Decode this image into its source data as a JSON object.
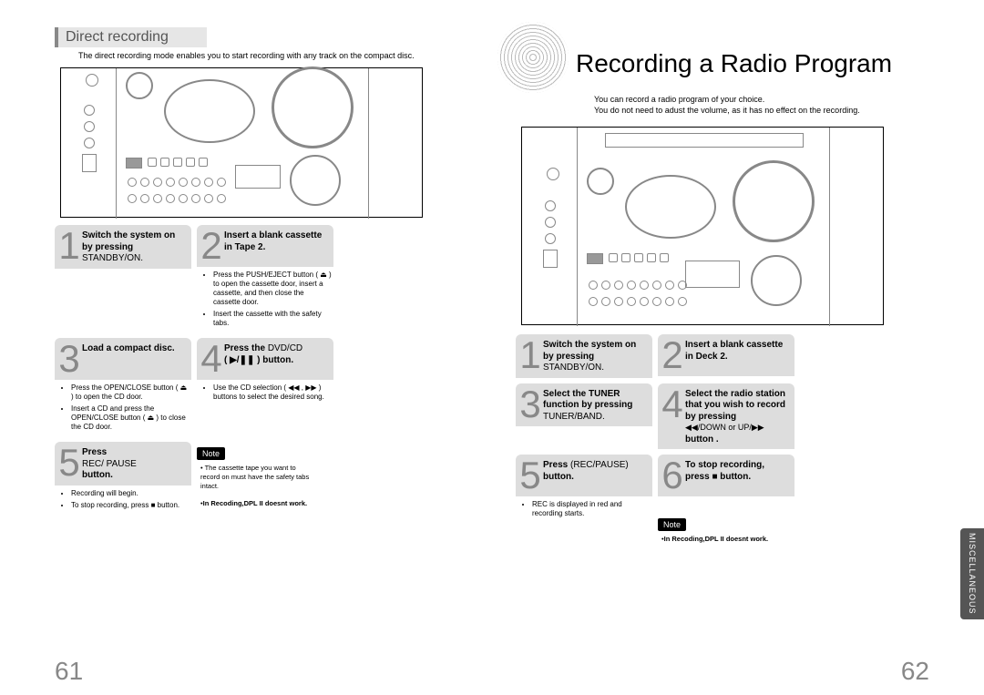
{
  "left": {
    "section_title": "Direct recording",
    "section_desc": "The direct recording mode enables you to start recording with any track on the compact disc.",
    "steps": [
      {
        "num": "1",
        "title_bold": "Switch the system on by pressing",
        "title_light": "STANDBY/ON."
      },
      {
        "num": "2",
        "title_bold": "Insert a blank cassette in Tape 2.",
        "body": [
          "Press the PUSH/EJECT button ( ⏏ ) to open the cassette door, insert a cassette, and then close the cassette door.",
          "Insert the cassette with the safety tabs."
        ]
      },
      {
        "num": "3",
        "title_bold": "Load a compact disc.",
        "body": [
          "Press the OPEN/CLOSE button ( ⏏ ) to open the CD door.",
          "Insert a CD and press the OPEN/CLOSE button ( ⏏ ) to close the CD door."
        ]
      },
      {
        "num": "4",
        "title_bold": "Press the",
        "title_mixed": "DVD/CD",
        "title_bold2": "( ▶/❚❚ ) button.",
        "body": [
          "Use the CD selection ( ◀◀ , ▶▶ ) buttons to select the desired song."
        ]
      },
      {
        "num": "5",
        "title_bold": "Press",
        "title_light": "REC/ PAUSE",
        "title_bold2": "button.",
        "body": [
          "Recording will begin.",
          "To stop recording, press ■ button."
        ]
      }
    ],
    "note_label": "Note",
    "note_lines": [
      "The cassette tape you want to record on must have the safety tabs intact.",
      "In Recoding,DPL II doesnt work."
    ],
    "page_number": "61"
  },
  "right": {
    "page_title": "Recording a Radio Program",
    "sub1": "You can record a radio program of your choice.",
    "sub2": "You do not need to adust the volume, as it has no effect on the recording.",
    "steps": [
      {
        "num": "1",
        "title_bold": "Switch the system on by pressing",
        "title_light": "STANDBY/ON."
      },
      {
        "num": "2",
        "title_bold": "Insert a blank cassette in Deck 2."
      },
      {
        "num": "3",
        "title_bold": "Select the TUNER function by pressing",
        "title_light": "TUNER/BAND."
      },
      {
        "num": "4",
        "title_bold": "Select the radio station that you wish to record by pressing",
        "title_mixed": "◀◀/DOWN or UP/▶▶",
        "title_bold2": "button ."
      },
      {
        "num": "5",
        "title_bold": "Press",
        "title_mixed": "(REC/PAUSE)",
        "title_bold2": "button.",
        "body": [
          "REC is displayed in red and recording starts."
        ]
      },
      {
        "num": "6",
        "title_bold": "To stop recording, press ■ button."
      }
    ],
    "note_label": "Note",
    "note_lines": [
      "In Recoding,DPL II doesnt work."
    ],
    "page_number": "62",
    "side_tab": "MISCELLANEOUS"
  }
}
